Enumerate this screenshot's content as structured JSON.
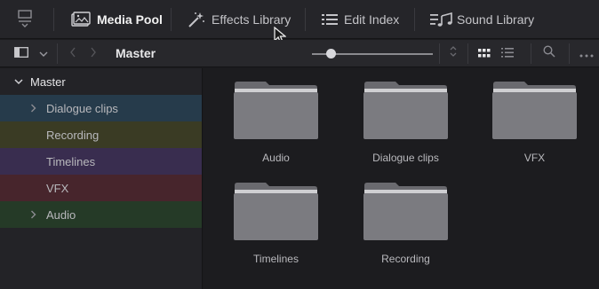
{
  "toolbar": {
    "pin_icon": "pin-icon",
    "items": [
      {
        "label": "Media Pool",
        "icon": "media-pool-icon",
        "active": true
      },
      {
        "label": "Effects Library",
        "icon": "effects-wand-icon",
        "active": false
      },
      {
        "label": "Edit Index",
        "icon": "list-icon",
        "active": false
      },
      {
        "label": "Sound Library",
        "icon": "music-note-icon",
        "active": false
      }
    ]
  },
  "subbar": {
    "breadcrumb": "Master",
    "zoom_level": 0.16
  },
  "sidebar": {
    "root": {
      "label": "Master",
      "expanded": true
    },
    "items": [
      {
        "label": "Dialogue clips",
        "color": "#263b4b",
        "has_children": true
      },
      {
        "label": "Recording",
        "color": "#3a3b24",
        "has_children": false
      },
      {
        "label": "Timelines",
        "color": "#392d4f",
        "has_children": false
      },
      {
        "label": "VFX",
        "color": "#47252c",
        "has_children": false
      },
      {
        "label": "Audio",
        "color": "#253a27",
        "has_children": true
      }
    ]
  },
  "bins": [
    {
      "label": "Audio"
    },
    {
      "label": "Dialogue clips"
    },
    {
      "label": "VFX"
    },
    {
      "label": "Timelines"
    },
    {
      "label": "Recording"
    }
  ],
  "colors": {
    "background": "#1b1b1e",
    "toolbar": "#252529",
    "folder": "#7b7b80",
    "folder_tab": "#6a6a6f"
  }
}
